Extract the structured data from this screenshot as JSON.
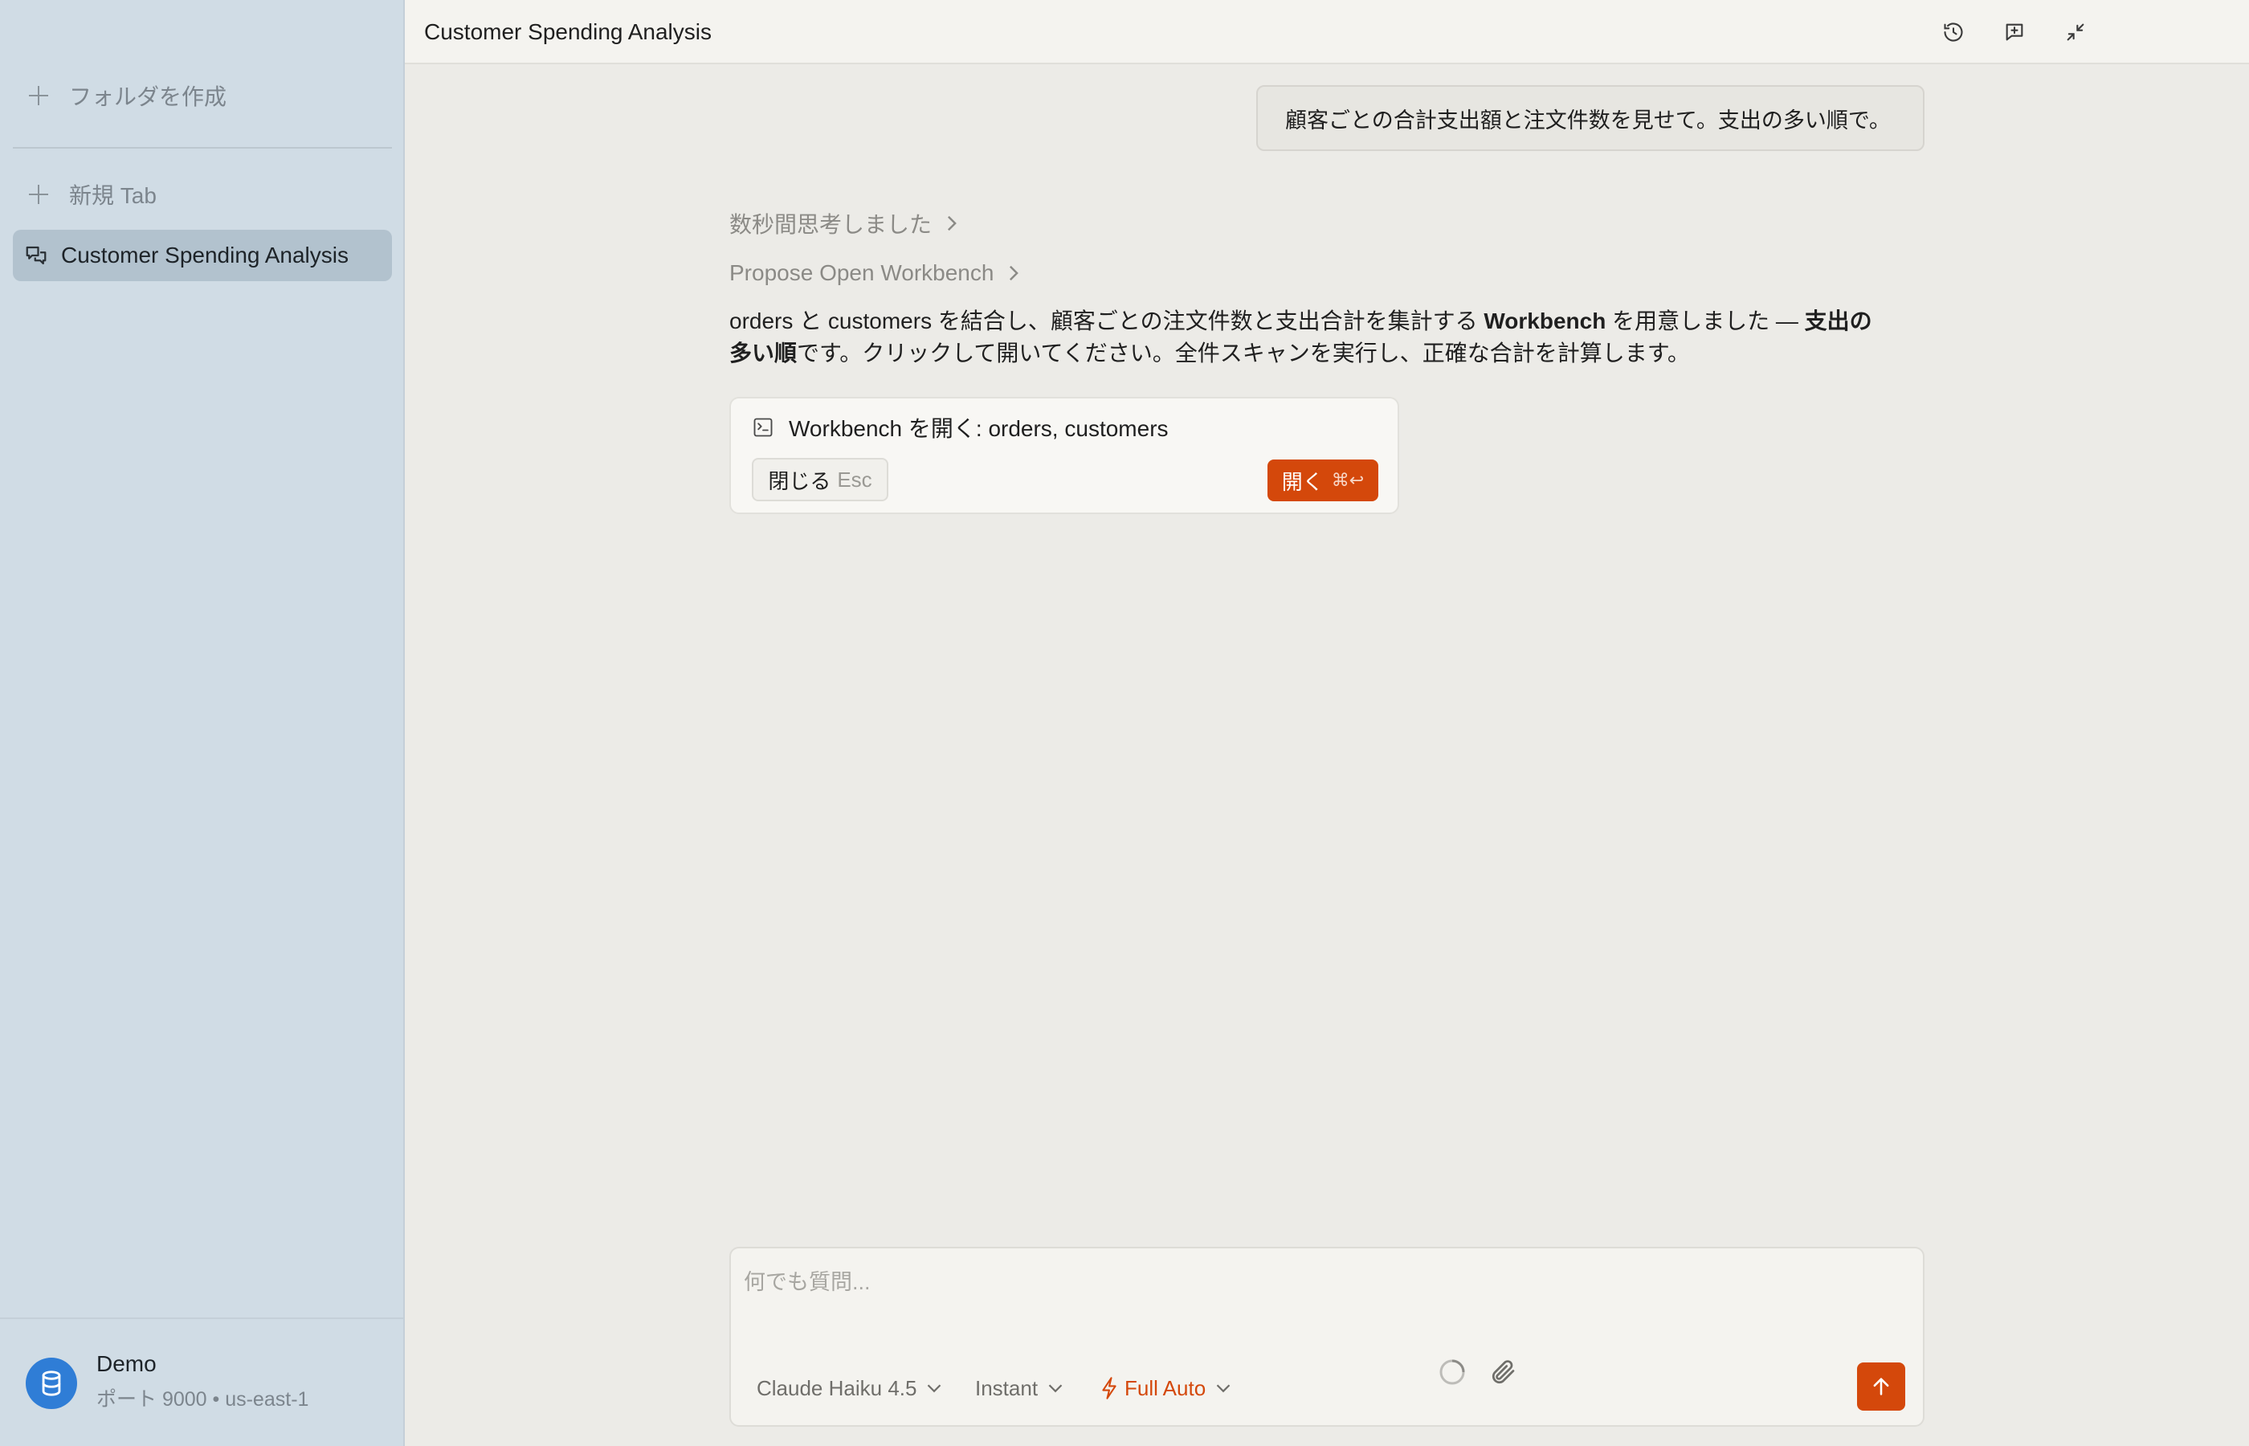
{
  "sidebar": {
    "create_folder": "フォルダを作成",
    "new_tab": "新規 Tab",
    "active_chat": "Customer Spending Analysis",
    "footer": {
      "name": "Demo",
      "subtitle": "ポート 9000 • us-east-1",
      "icon": "database-icon"
    }
  },
  "header": {
    "title": "Customer Spending Analysis",
    "icons": [
      "history-icon",
      "new-chat-icon",
      "collapse-icon"
    ]
  },
  "conversation": {
    "user_message": "顧客ごとの合計支出額と注文件数を見せて。支出の多い順で。",
    "thinking_label": "数秒間思考しました",
    "tool_label": "Propose Open Workbench",
    "answer": {
      "part1": "orders と customers を結合し、顧客ごとの注文件数と支出合計を集計する ",
      "bold1": "Workbench",
      "part2": " を用意しました — ",
      "bold2": "支出の多い順",
      "part3": "です。クリックして開いてください。全件スキャンを実行し、正確な合計を計算します。"
    },
    "card": {
      "title": "Workbench を開く: orders, customers",
      "close_label": "閉じる",
      "close_hint": "Esc",
      "open_label": "開く",
      "open_hint": "⌘↩"
    }
  },
  "composer": {
    "placeholder": "何でも質問...",
    "model": "Claude Haiku 4.5",
    "speed": "Instant",
    "mode": "Full Auto",
    "accent": "#d4480b"
  }
}
